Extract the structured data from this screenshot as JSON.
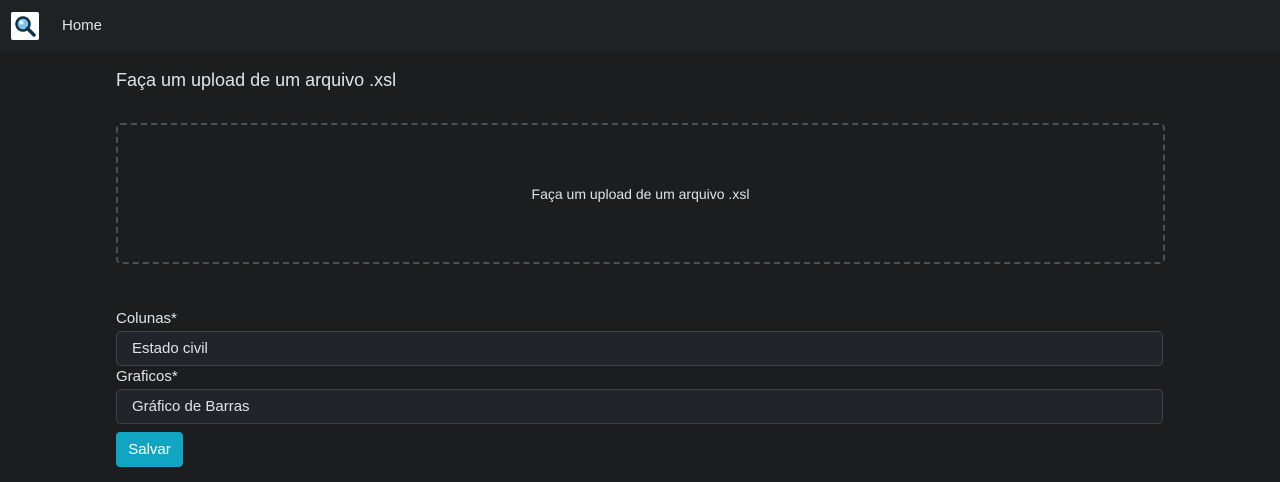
{
  "navbar": {
    "logo_icon": "magnifier-icon",
    "home_label": "Home"
  },
  "main": {
    "title": "Faça um upload de um arquivo .xsl",
    "dropzone_text": "Faça um upload de um arquivo .xsl",
    "columns": {
      "label": "Colunas*",
      "value": "Estado civil"
    },
    "charts": {
      "label": "Graficos*",
      "value": "Gráfico de Barras"
    },
    "save_label": "Salvar"
  },
  "colors": {
    "background": "#1b1d1f",
    "navbar": "#1f2224",
    "accent": "#0fa5c3"
  }
}
